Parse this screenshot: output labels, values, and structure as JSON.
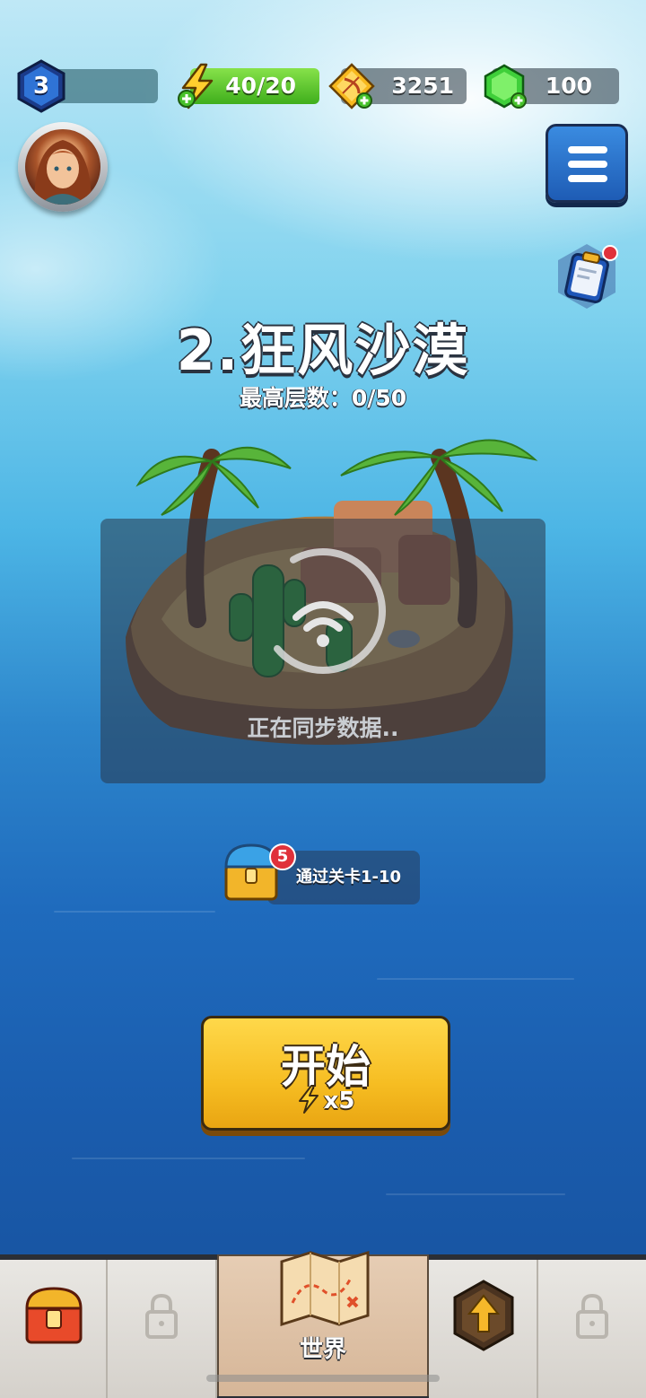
{
  "player": {
    "level": "3"
  },
  "resources": {
    "energy": {
      "value": "40/20",
      "icon": "lightning-plus-icon"
    },
    "gold": {
      "value": "3251",
      "icon": "gold-bow-plus-icon"
    },
    "gems": {
      "value": "100",
      "icon": "green-gem-plus-icon"
    }
  },
  "stage": {
    "title": "2.狂风沙漠",
    "best_floor": "最高层数：0/50"
  },
  "sync": {
    "message": "正在同步数据.."
  },
  "chest": {
    "badge": "5",
    "label": "通过关卡1-10"
  },
  "start_button": {
    "label": "开始",
    "cost": "x5"
  },
  "nav": {
    "world_label": "世界"
  },
  "colors": {
    "start": "#f6bd22",
    "energy": "#5bc42c",
    "menu": "#2a6fcb"
  }
}
